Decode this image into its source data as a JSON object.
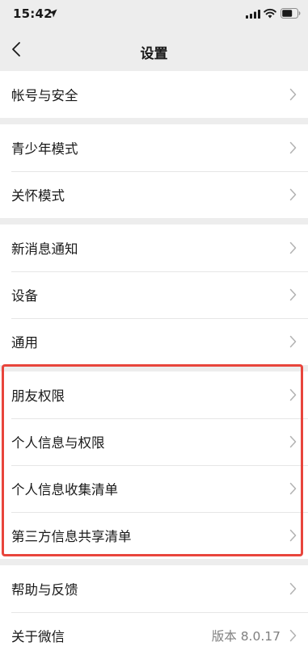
{
  "status_bar": {
    "time": "15:42"
  },
  "nav": {
    "title": "设置"
  },
  "groups": [
    {
      "items": [
        {
          "label": "帐号与安全"
        }
      ]
    },
    {
      "items": [
        {
          "label": "青少年模式"
        },
        {
          "label": "关怀模式"
        }
      ]
    },
    {
      "items": [
        {
          "label": "新消息通知"
        },
        {
          "label": "设备"
        },
        {
          "label": "通用"
        }
      ]
    },
    {
      "items": [
        {
          "label": "朋友权限"
        },
        {
          "label": "个人信息与权限"
        },
        {
          "label": "个人信息收集清单"
        },
        {
          "label": "第三方信息共享清单"
        }
      ]
    },
    {
      "items": [
        {
          "label": "帮助与反馈"
        },
        {
          "label": "关于微信",
          "value": "版本 8.0.17"
        }
      ]
    }
  ],
  "highlight_color": "#e8453c"
}
